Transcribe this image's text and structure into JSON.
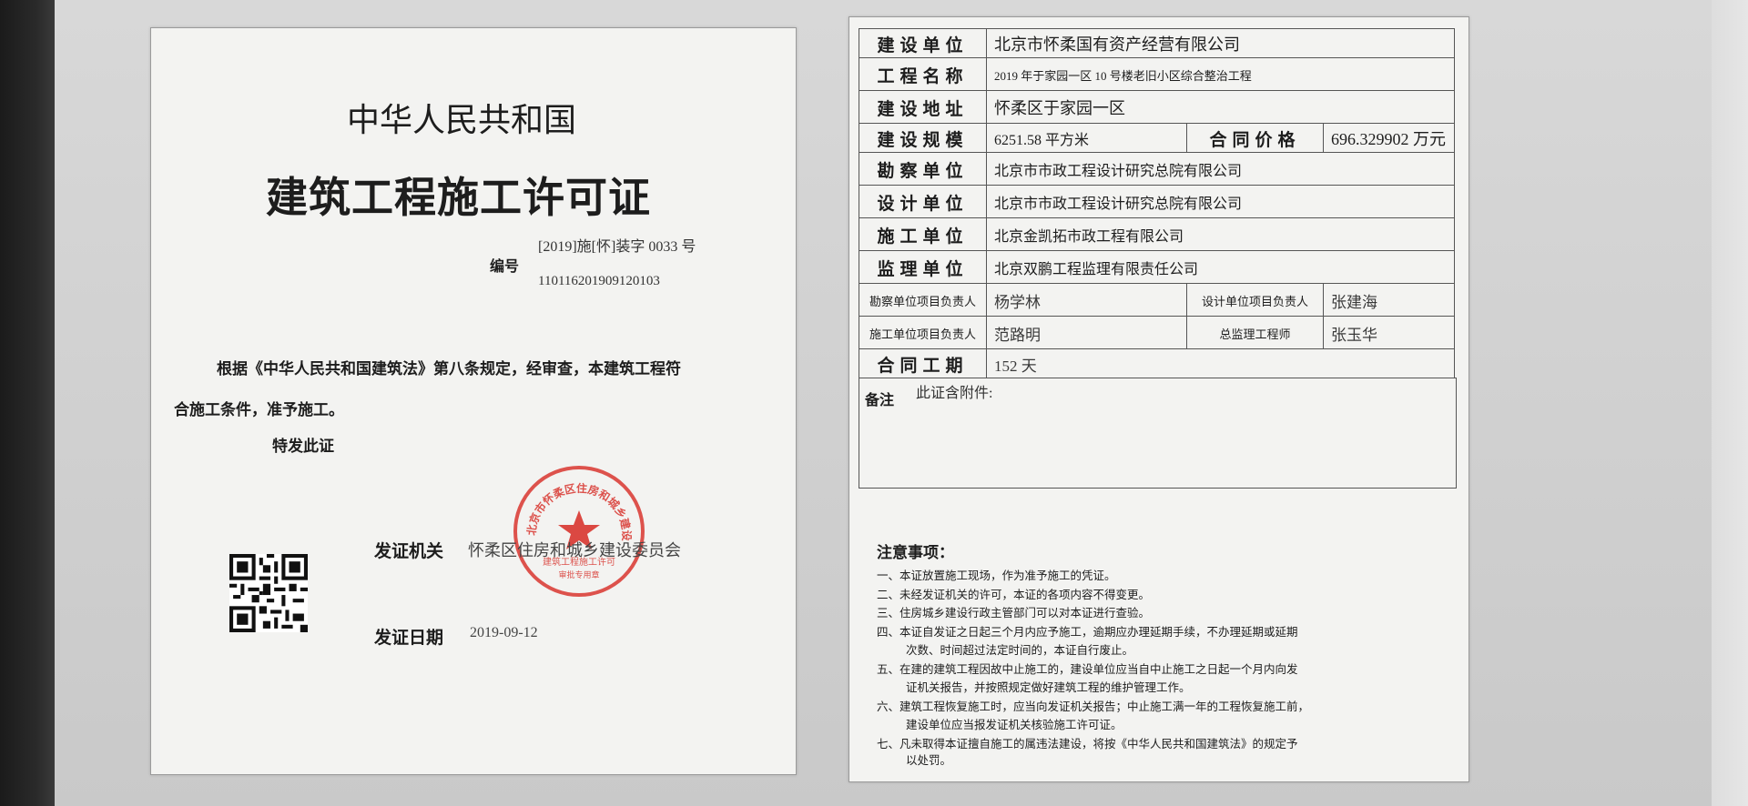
{
  "left": {
    "country": "中华人民共和国",
    "title": "建筑工程施工许可证",
    "number_label": "编号",
    "number_line1": "[2019]施[怀]装字 0033 号",
    "number_line2": "110116201909120103",
    "body_line1": "根据《中华人民共和国建筑法》第八条规定，经审查，本建筑工程符",
    "body_line2": "合施工条件，准予施工。",
    "special": "特发此证",
    "issuer_label": "发证机关",
    "issuer_value": "怀柔区住房和城乡建设委员会",
    "date_label": "发证日期",
    "date_value": "2019-09-12",
    "seal_ring_text": "北京市怀柔区住房和城乡建设委员会",
    "seal_bottom_text": "建筑工程施工许可",
    "seal_bottom_text2": "审批专用章",
    "seal_color": "#d8352f"
  },
  "right": {
    "rows": [
      {
        "label": "建设单位",
        "value": "北京市怀柔国有资产经营有限公司"
      },
      {
        "label": "工程名称",
        "value": "2019 年于家园一区 10 号楼老旧小区综合整治工程"
      },
      {
        "label": "建设地址",
        "value": "怀柔区于家园一区"
      },
      {
        "label": "建设规模",
        "value": "6251.58 平方米",
        "label2": "合同价格",
        "value2": "696.329902 万元"
      },
      {
        "label": "勘察单位",
        "value": "北京市市政工程设计研究总院有限公司"
      },
      {
        "label": "设计单位",
        "value": "北京市市政工程设计研究总院有限公司"
      },
      {
        "label": "施工单位",
        "value": "北京金凯拓市政工程有限公司"
      },
      {
        "label": "监理单位",
        "value": "北京双鹏工程监理有限责任公司"
      },
      {
        "label": "勘察单位项目负责人",
        "value": "杨学林",
        "label2": "设计单位项目负责人",
        "value2": "张建海"
      },
      {
        "label": "施工单位项目负责人",
        "value": "范路明",
        "label2": "总监理工程师",
        "value2": "张玉华"
      },
      {
        "label": "合同工期",
        "value": "152 天"
      }
    ],
    "remarks_label": "备注",
    "remarks_value": "此证含附件:",
    "notes_title": "注意事项：",
    "notes": [
      "一、本证放置施工现场，作为准予施工的凭证。",
      "二、未经发证机关的许可，本证的各项内容不得变更。",
      "三、住房城乡建设行政主管部门可以对本证进行查验。",
      "四、本证自发证之日起三个月内应予施工，逾期应办理延期手续，不办理延期或延期",
      "次数、时间超过法定时间的，本证自行废止。",
      "五、在建的建筑工程因故中止施工的，建设单位应当自中止施工之日起一个月内向发",
      "证机关报告，并按照规定做好建筑工程的维护管理工作。",
      "六、建筑工程恢复施工时，应当向发证机关报告；中止施工满一年的工程恢复施工前，",
      "建设单位应当报发证机关核验施工许可证。",
      "七、凡未取得本证擅自施工的属违法建设，将按《中华人民共和国建筑法》的规定予",
      "以处罚。"
    ]
  }
}
